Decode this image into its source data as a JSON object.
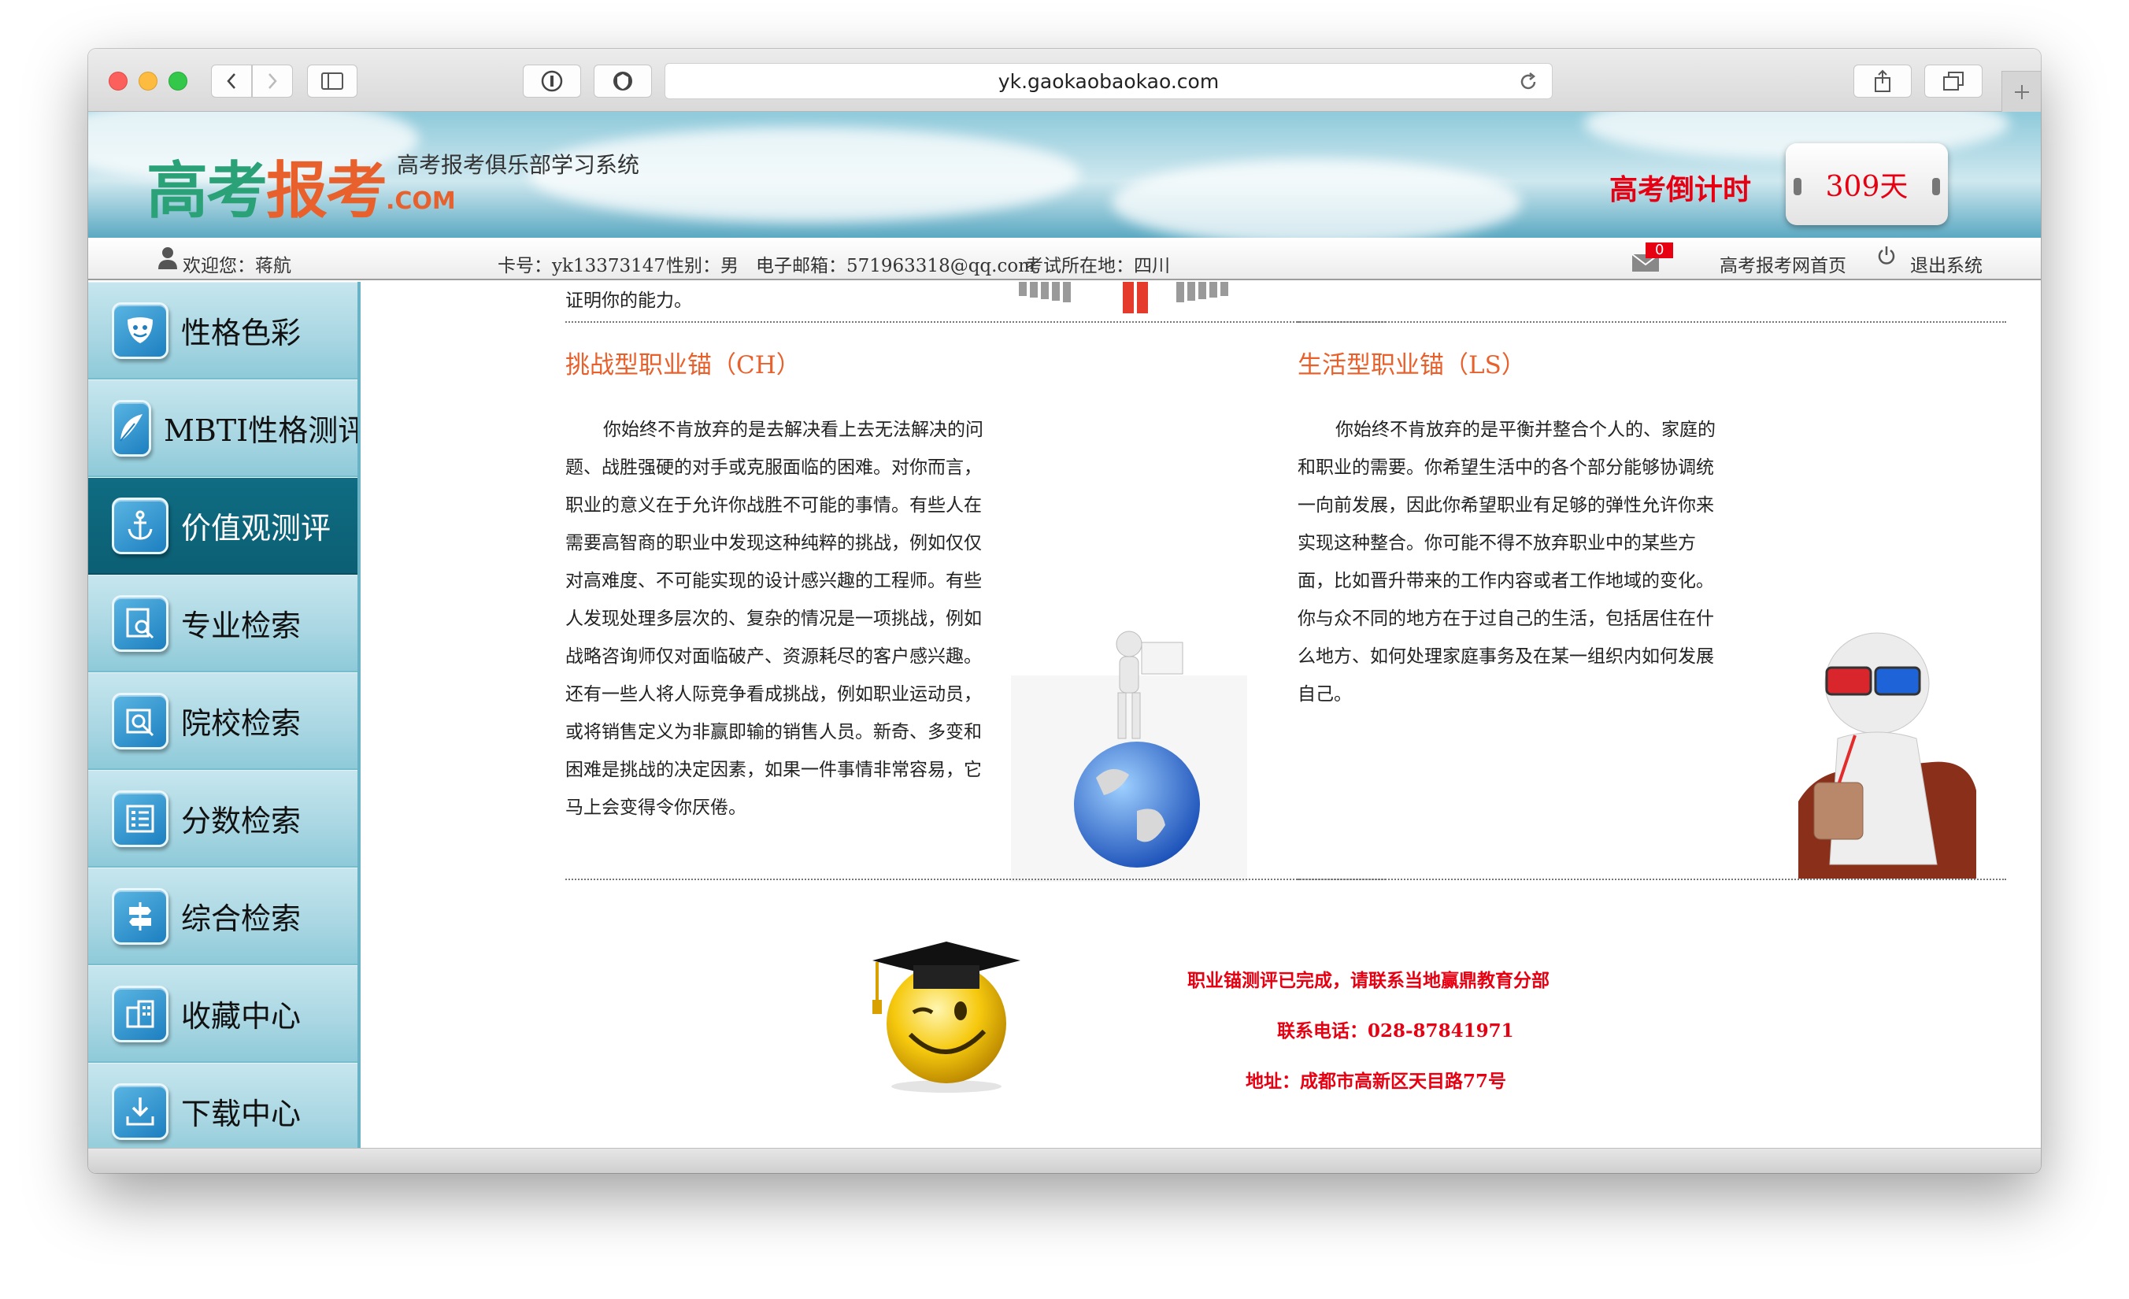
{
  "browser": {
    "url": "yk.gaokaobaokao.com"
  },
  "header": {
    "logo_main_1": "高考",
    "logo_main_2": "报考",
    "logo_com": ".COM",
    "logo_subtitle": "高考报考俱乐部学习系统",
    "countdown_label": "高考倒计时",
    "countdown_value": "309天"
  },
  "userbar": {
    "welcome": "欢迎您：蒋航",
    "card_no": "卡号：yk13373147",
    "gender": "性别：男",
    "email": "电子邮箱：571963318@qq.com",
    "exam_location": "考试所在地：四川",
    "mail_count": "0",
    "home_link": "高考报考网首页",
    "logout_link": "退出系统"
  },
  "sidebar": {
    "items": [
      {
        "label": "性格色彩",
        "icon": "mask-icon"
      },
      {
        "label": "MBTI性格测评",
        "icon": "feather-icon"
      },
      {
        "label": "价值观测评",
        "icon": "anchor-icon",
        "active": true
      },
      {
        "label": "专业检索",
        "icon": "document-search-icon"
      },
      {
        "label": "院校检索",
        "icon": "school-search-icon"
      },
      {
        "label": "分数检索",
        "icon": "list-icon"
      },
      {
        "label": "综合检索",
        "icon": "signpost-icon"
      },
      {
        "label": "收藏中心",
        "icon": "building-icon"
      },
      {
        "label": "下载中心",
        "icon": "download-icon"
      }
    ]
  },
  "content": {
    "prev_fragment": "证明你的能力。",
    "left": {
      "title": "挑战型职业锚（CH）",
      "lines": [
        "你始终不肯放弃的是去解决看上去无法解决的问",
        "题、战胜强硬的对手或克服面临的困难。对你而言，",
        "职业的意义在于允许你战胜不可能的事情。有些人在",
        "需要高智商的职业中发现这种纯粹的挑战，例如仅仅",
        "对高难度、不可能实现的设计感兴趣的工程师。有些",
        "人发现处理多层次的、复杂的情况是一项挑战，例如",
        "战略咨询师仅对面临破产、资源耗尽的客户感兴趣。",
        "还有一些人将人际竞争看成挑战，例如职业运动员，",
        "或将销售定义为非赢即输的销售人员。新奇、多变和",
        "困难是挑战的决定因素，如果一件事情非常容易，它",
        "马上会变得令你厌倦。"
      ]
    },
    "right": {
      "title": "生活型职业锚（LS）",
      "lines": [
        "你始终不肯放弃的是平衡并整合个人的、家庭的",
        "和职业的需要。你希望生活中的各个部分能够协调统",
        "一向前发展，因此你希望职业有足够的弹性允许你来",
        "实现这种整合。你可能不得不放弃职业中的某些方",
        "面，比如晋升带来的工作内容或者工作地域的变化。",
        "你与众不同的地方在于过自己的生活，包括居住在什",
        "么地方、如何处理家庭事务及在某一组织内如何发展",
        "自己。"
      ]
    },
    "notice": {
      "line1": "职业锚测评已完成，请联系当地赢鼎教育分部",
      "line2": "联系电话：028-87841971",
      "line3": "地址：成都市高新区天目路77号"
    }
  }
}
